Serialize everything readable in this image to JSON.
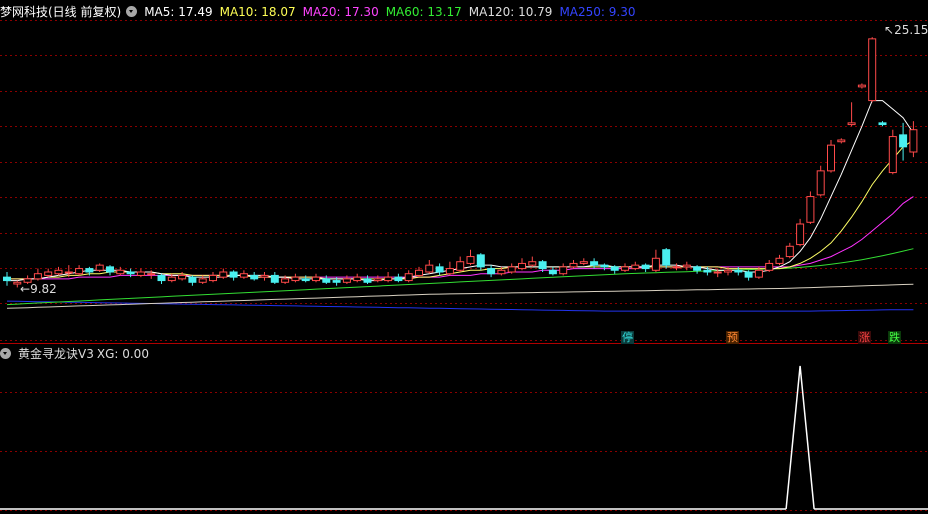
{
  "header": {
    "title": "梦网科技(日线 前复权)",
    "ma": [
      {
        "label": "MA5: 17.49",
        "color": "#ffffff"
      },
      {
        "label": "MA10: 18.07",
        "color": "#ffff55"
      },
      {
        "label": "MA20: 17.30",
        "color": "#ff44ff"
      },
      {
        "label": "MA60: 13.17",
        "color": "#33ee33"
      },
      {
        "label": "MA120: 10.79",
        "color": "#dddddd"
      },
      {
        "label": "MA250: 9.30",
        "color": "#3344ff"
      }
    ]
  },
  "price_labels": {
    "high": "25.15",
    "low": "9.82"
  },
  "markers": [
    {
      "text": "停",
      "color": "#33dddd",
      "bg": "#0a3a3a"
    },
    {
      "text": "预",
      "color": "#ff8833",
      "bg": "#4a2200"
    },
    {
      "text": "涨",
      "color": "#ff4444",
      "bg": "#3a0a0a"
    },
    {
      "text": "跌",
      "color": "#44ff44",
      "bg": "#0a3a0a"
    }
  ],
  "indicator": {
    "title": "黄金寻龙诀V3",
    "value_label": "XG: 0.00"
  },
  "colors": {
    "up": "#ff4a4a",
    "down": "#4af0f0",
    "grid": "#8b0000",
    "signal": "#ffffff"
  },
  "chart_data": {
    "type": "candlestick",
    "candles": [
      [
        11.2,
        11.0,
        11.5,
        10.7
      ],
      [
        10.8,
        10.9,
        11.0,
        10.6
      ],
      [
        10.9,
        11.1,
        11.3,
        10.8
      ],
      [
        11.1,
        11.4,
        11.7,
        11.0
      ],
      [
        11.3,
        11.5,
        11.7,
        11.2
      ],
      [
        11.4,
        11.6,
        11.8,
        11.3
      ],
      [
        11.5,
        11.5,
        11.9,
        11.2
      ],
      [
        11.4,
        11.7,
        11.9,
        11.3
      ],
      [
        11.7,
        11.5,
        11.8,
        11.3
      ],
      [
        11.6,
        11.9,
        12.0,
        11.5
      ],
      [
        11.8,
        11.5,
        11.9,
        11.3
      ],
      [
        11.4,
        11.6,
        11.8,
        11.3
      ],
      [
        11.5,
        11.4,
        11.7,
        11.2
      ],
      [
        11.3,
        11.5,
        11.7,
        11.2
      ],
      [
        11.4,
        11.4,
        11.6,
        11.1
      ],
      [
        11.3,
        11.0,
        11.4,
        10.8
      ],
      [
        11.0,
        11.2,
        11.4,
        10.9
      ],
      [
        11.1,
        11.3,
        11.5,
        11.0
      ],
      [
        11.2,
        10.9,
        11.3,
        10.7
      ],
      [
        10.9,
        11.1,
        11.3,
        10.8
      ],
      [
        11.0,
        11.3,
        11.5,
        10.9
      ],
      [
        11.2,
        11.5,
        11.7,
        11.1
      ],
      [
        11.5,
        11.2,
        11.6,
        11.0
      ],
      [
        11.2,
        11.4,
        11.6,
        11.1
      ],
      [
        11.3,
        11.1,
        11.5,
        11.0
      ],
      [
        11.2,
        11.3,
        11.5,
        11.0
      ],
      [
        11.3,
        10.9,
        11.5,
        10.8
      ],
      [
        10.9,
        11.1,
        11.3,
        10.8
      ],
      [
        11.0,
        11.2,
        11.4,
        10.9
      ],
      [
        11.1,
        11.0,
        11.3,
        10.9
      ],
      [
        11.0,
        11.2,
        11.4,
        10.9
      ],
      [
        11.1,
        10.9,
        11.3,
        10.8
      ],
      [
        11.0,
        10.9,
        11.2,
        10.7
      ],
      [
        10.9,
        11.1,
        11.3,
        10.8
      ],
      [
        11.0,
        11.2,
        11.4,
        10.9
      ],
      [
        11.1,
        10.9,
        11.3,
        10.8
      ],
      [
        11.0,
        11.1,
        11.3,
        10.9
      ],
      [
        11.0,
        11.2,
        11.5,
        10.9
      ],
      [
        11.2,
        11.0,
        11.4,
        10.9
      ],
      [
        11.0,
        11.4,
        11.6,
        10.9
      ],
      [
        11.3,
        11.6,
        11.8,
        11.2
      ],
      [
        11.5,
        11.9,
        12.2,
        11.4
      ],
      [
        11.8,
        11.5,
        12.0,
        11.3
      ],
      [
        11.4,
        11.7,
        12.1,
        11.3
      ],
      [
        11.6,
        12.1,
        12.4,
        11.5
      ],
      [
        12.0,
        12.4,
        12.8,
        11.9
      ],
      [
        12.5,
        11.8,
        12.6,
        11.6
      ],
      [
        11.7,
        11.4,
        11.9,
        11.2
      ],
      [
        11.4,
        11.6,
        11.8,
        11.3
      ],
      [
        11.5,
        11.8,
        12.0,
        11.4
      ],
      [
        11.7,
        12.0,
        12.3,
        11.6
      ],
      [
        11.9,
        12.1,
        12.4,
        11.8
      ],
      [
        12.1,
        11.7,
        12.2,
        11.5
      ],
      [
        11.6,
        11.4,
        11.8,
        11.3
      ],
      [
        11.4,
        11.8,
        12.0,
        11.3
      ],
      [
        11.8,
        12.0,
        12.2,
        11.7
      ],
      [
        12.0,
        12.1,
        12.3,
        11.9
      ],
      [
        12.1,
        11.9,
        12.3,
        11.7
      ],
      [
        11.9,
        11.8,
        12.0,
        11.6
      ],
      [
        11.8,
        11.6,
        11.9,
        11.4
      ],
      [
        11.6,
        11.8,
        12.0,
        11.5
      ],
      [
        11.7,
        11.9,
        12.1,
        11.6
      ],
      [
        11.9,
        11.7,
        12.0,
        11.5
      ],
      [
        11.6,
        12.3,
        12.8,
        11.5
      ],
      [
        12.8,
        11.9,
        12.9,
        11.7
      ],
      [
        11.8,
        11.8,
        12.0,
        11.6
      ],
      [
        11.8,
        11.9,
        12.1,
        11.6
      ],
      [
        11.8,
        11.6,
        11.9,
        11.4
      ],
      [
        11.6,
        11.5,
        11.8,
        11.3
      ],
      [
        11.5,
        11.5,
        11.7,
        11.2
      ],
      [
        11.5,
        11.6,
        11.8,
        11.3
      ],
      [
        11.6,
        11.5,
        11.8,
        11.3
      ],
      [
        11.5,
        11.2,
        11.6,
        11.0
      ],
      [
        11.2,
        11.6,
        11.8,
        11.1
      ],
      [
        11.6,
        12.0,
        12.2,
        11.5
      ],
      [
        12.0,
        12.3,
        12.5,
        11.9
      ],
      [
        12.4,
        13.0,
        13.2,
        12.3
      ],
      [
        13.1,
        14.3,
        14.6,
        13.0
      ],
      [
        14.4,
        15.9,
        16.2,
        14.3
      ],
      [
        16.0,
        17.4,
        17.7,
        15.9
      ],
      [
        17.4,
        18.9,
        19.2,
        17.3
      ],
      [
        19.1,
        19.2,
        19.3,
        19.0
      ],
      [
        20.1,
        20.2,
        21.4,
        20.0
      ],
      [
        22.3,
        22.4,
        22.5,
        22.2
      ],
      [
        21.5,
        25.1,
        25.2,
        21.4
      ],
      [
        20.2,
        20.1,
        20.3,
        20.0
      ],
      [
        17.3,
        19.4,
        19.8,
        17.2
      ],
      [
        19.5,
        18.8,
        20.2,
        18.0
      ],
      [
        18.5,
        19.8,
        20.3,
        18.2
      ]
    ],
    "ma5": [
      11.0,
      11.0,
      11.1,
      11.1,
      11.2,
      11.3,
      11.4,
      11.5,
      11.6,
      11.6,
      11.6,
      11.6,
      11.5,
      11.5,
      11.5,
      11.4,
      11.3,
      11.3,
      11.2,
      11.2,
      11.2,
      11.2,
      11.3,
      11.3,
      11.3,
      11.3,
      11.2,
      11.2,
      11.1,
      11.1,
      11.1,
      11.1,
      11.1,
      11.1,
      11.1,
      11.0,
      11.0,
      11.1,
      11.1,
      11.2,
      11.3,
      11.4,
      11.5,
      11.6,
      11.7,
      11.8,
      11.9,
      11.9,
      11.8,
      11.8,
      11.8,
      11.8,
      11.8,
      11.8,
      11.8,
      11.8,
      11.8,
      11.9,
      11.9,
      11.8,
      11.8,
      11.8,
      11.8,
      11.9,
      11.9,
      11.9,
      11.8,
      11.8,
      11.7,
      11.6,
      11.6,
      11.6,
      11.5,
      11.5,
      11.6,
      11.8,
      12.1,
      12.7,
      13.5,
      14.6,
      15.9,
      17.2,
      18.6,
      20.0,
      21.5,
      21.5,
      21.0,
      20.5,
      19.6
    ],
    "ma10": [
      11.1,
      11.1,
      11.1,
      11.1,
      11.2,
      11.2,
      11.3,
      11.3,
      11.4,
      11.4,
      11.5,
      11.5,
      11.5,
      11.5,
      11.5,
      11.4,
      11.4,
      11.4,
      11.3,
      11.3,
      11.3,
      11.3,
      11.3,
      11.3,
      11.2,
      11.2,
      11.2,
      11.2,
      11.2,
      11.2,
      11.2,
      11.1,
      11.1,
      11.1,
      11.1,
      11.1,
      11.1,
      11.1,
      11.1,
      11.1,
      11.2,
      11.2,
      11.3,
      11.4,
      11.5,
      11.6,
      11.6,
      11.7,
      11.7,
      11.8,
      11.8,
      11.8,
      11.8,
      11.8,
      11.8,
      11.8,
      11.8,
      11.8,
      11.8,
      11.8,
      11.8,
      11.8,
      11.8,
      11.8,
      11.8,
      11.8,
      11.8,
      11.8,
      11.8,
      11.8,
      11.7,
      11.7,
      11.7,
      11.7,
      11.7,
      11.7,
      11.8,
      12.0,
      12.3,
      12.7,
      13.2,
      13.9,
      14.7,
      15.6,
      16.6,
      17.4,
      18.1,
      18.8,
      19.2
    ],
    "ma20": [
      11.1,
      11.1,
      11.1,
      11.1,
      11.1,
      11.1,
      11.1,
      11.2,
      11.2,
      11.2,
      11.2,
      11.3,
      11.3,
      11.3,
      11.3,
      11.3,
      11.3,
      11.3,
      11.3,
      11.3,
      11.3,
      11.3,
      11.3,
      11.3,
      11.2,
      11.2,
      11.2,
      11.2,
      11.2,
      11.2,
      11.2,
      11.2,
      11.2,
      11.2,
      11.2,
      11.2,
      11.2,
      11.2,
      11.2,
      11.2,
      11.2,
      11.2,
      11.2,
      11.3,
      11.3,
      11.3,
      11.4,
      11.4,
      11.4,
      11.5,
      11.5,
      11.5,
      11.6,
      11.6,
      11.6,
      11.7,
      11.7,
      11.7,
      11.7,
      11.7,
      11.7,
      11.7,
      11.8,
      11.8,
      11.8,
      11.8,
      11.8,
      11.8,
      11.8,
      11.8,
      11.8,
      11.8,
      11.8,
      11.8,
      11.8,
      11.8,
      11.8,
      11.9,
      12.0,
      12.2,
      12.4,
      12.7,
      13.0,
      13.4,
      13.9,
      14.4,
      14.9,
      15.5,
      15.9
    ],
    "ma60": [
      9.6,
      9.63,
      9.66,
      9.69,
      9.72,
      9.75,
      9.78,
      9.81,
      9.84,
      9.87,
      9.9,
      9.93,
      9.96,
      9.99,
      10.02,
      10.05,
      10.08,
      10.11,
      10.14,
      10.17,
      10.2,
      10.23,
      10.26,
      10.29,
      10.32,
      10.35,
      10.38,
      10.41,
      10.44,
      10.47,
      10.5,
      10.53,
      10.56,
      10.59,
      10.62,
      10.65,
      10.68,
      10.71,
      10.74,
      10.77,
      10.8,
      10.83,
      10.86,
      10.89,
      10.92,
      10.95,
      10.98,
      11.01,
      11.04,
      11.07,
      11.1,
      11.13,
      11.16,
      11.19,
      11.22,
      11.25,
      11.28,
      11.31,
      11.34,
      11.37,
      11.4,
      11.42,
      11.44,
      11.46,
      11.48,
      11.5,
      11.52,
      11.54,
      11.56,
      11.58,
      11.6,
      11.62,
      11.64,
      11.66,
      11.68,
      11.7,
      11.73,
      11.77,
      11.82,
      11.88,
      11.95,
      12.03,
      12.12,
      12.22,
      12.33,
      12.45,
      12.58,
      12.72,
      12.86
    ],
    "ma120": [
      9.38,
      9.4,
      9.42,
      9.44,
      9.46,
      9.48,
      9.5,
      9.52,
      9.54,
      9.56,
      9.58,
      9.6,
      9.62,
      9.64,
      9.66,
      9.68,
      9.7,
      9.72,
      9.74,
      9.76,
      9.78,
      9.8,
      9.82,
      9.84,
      9.86,
      9.88,
      9.9,
      9.92,
      9.94,
      9.96,
      9.98,
      10.0,
      10.02,
      10.04,
      10.06,
      10.08,
      10.1,
      10.12,
      10.14,
      10.16,
      10.18,
      10.2,
      10.21,
      10.22,
      10.23,
      10.24,
      10.25,
      10.26,
      10.27,
      10.28,
      10.29,
      10.3,
      10.31,
      10.32,
      10.33,
      10.34,
      10.35,
      10.36,
      10.37,
      10.38,
      10.39,
      10.4,
      10.41,
      10.42,
      10.43,
      10.44,
      10.45,
      10.46,
      10.47,
      10.48,
      10.49,
      10.5,
      10.51,
      10.52,
      10.53,
      10.54,
      10.55,
      10.57,
      10.59,
      10.61,
      10.63,
      10.65,
      10.67,
      10.69,
      10.71,
      10.73,
      10.75,
      10.77,
      10.79
    ],
    "ma250": [
      9.8,
      9.79,
      9.78,
      9.77,
      9.76,
      9.75,
      9.74,
      9.73,
      9.72,
      9.71,
      9.7,
      9.69,
      9.68,
      9.67,
      9.66,
      9.65,
      9.64,
      9.63,
      9.62,
      9.61,
      9.6,
      9.59,
      9.58,
      9.57,
      9.56,
      9.55,
      9.54,
      9.53,
      9.52,
      9.51,
      9.5,
      9.49,
      9.48,
      9.47,
      9.46,
      9.45,
      9.44,
      9.43,
      9.42,
      9.41,
      9.4,
      9.39,
      9.38,
      9.37,
      9.36,
      9.35,
      9.34,
      9.33,
      9.32,
      9.31,
      9.3,
      9.29,
      9.28,
      9.27,
      9.26,
      9.25,
      9.24,
      9.23,
      9.22,
      9.22,
      9.22,
      9.22,
      9.22,
      9.22,
      9.22,
      9.22,
      9.22,
      9.22,
      9.22,
      9.22,
      9.22,
      9.22,
      9.22,
      9.22,
      9.22,
      9.22,
      9.22,
      9.22,
      9.22,
      9.23,
      9.24,
      9.25,
      9.26,
      9.27,
      9.28,
      9.29,
      9.3,
      9.3,
      9.3
    ],
    "xg_signal": {
      "index": 77,
      "value": 1
    },
    "price_range": [
      8.0,
      26.2
    ]
  }
}
